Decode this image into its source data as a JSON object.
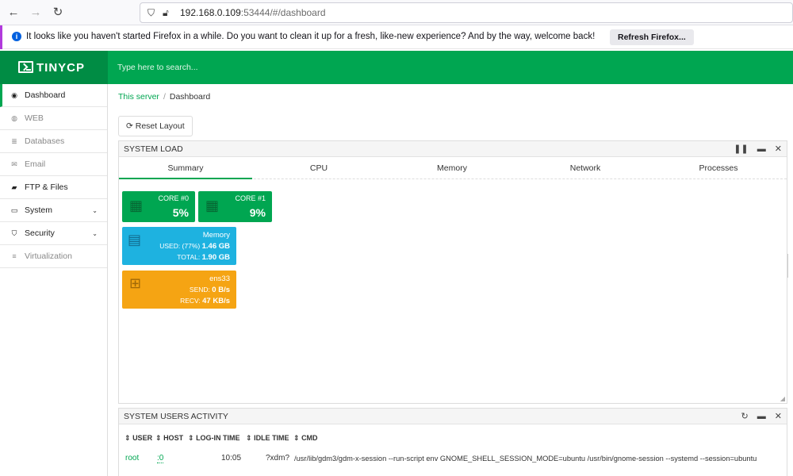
{
  "browser": {
    "back_icon": "←",
    "forward_icon": "→",
    "reload_icon": "↻",
    "url_host": "192.168.0.109",
    "url_rest": ":53444/#/dashboard"
  },
  "notification": {
    "text": "It looks like you haven't started Firefox in a while. Do you want to clean it up for a fresh, like-new experience? And by the way, welcome back!",
    "button": "Refresh Firefox..."
  },
  "header": {
    "logo": "TINYCP",
    "search_placeholder": "Type here to search..."
  },
  "sidebar": {
    "items": [
      {
        "label": "Dashboard",
        "icon": "◉"
      },
      {
        "label": "WEB",
        "icon": "◍"
      },
      {
        "label": "Databases",
        "icon": "≣"
      },
      {
        "label": "Email",
        "icon": "✉"
      },
      {
        "label": "FTP & Files",
        "icon": "▰"
      },
      {
        "label": "System",
        "icon": "▭",
        "chevron": "⌄"
      },
      {
        "label": "Security",
        "icon": "⛉",
        "chevron": "⌄"
      },
      {
        "label": "Virtualization",
        "icon": "≡"
      }
    ]
  },
  "breadcrumb": {
    "link": "This server",
    "sep": "/",
    "current": "Dashboard"
  },
  "reset_button": "Reset Layout",
  "system_load": {
    "title": "SYSTEM LOAD",
    "tools": [
      "❚❚",
      "▬",
      "✕"
    ],
    "tabs": [
      "Summary",
      "CPU",
      "Memory",
      "Network",
      "Processes"
    ],
    "cores": [
      {
        "label": "CORE #0",
        "value": "5%"
      },
      {
        "label": "CORE #1",
        "value": "9%"
      }
    ],
    "memory": {
      "title": "Memory",
      "used_label": "USED: (77%)",
      "used_value": "1.46 GB",
      "total_label": "TOTAL:",
      "total_value": "1.90 GB"
    },
    "network": {
      "title": "ens33",
      "send_label": "SEND:",
      "send_value": "0 B/s",
      "recv_label": "RECV:",
      "recv_value": "47 KB/s"
    },
    "colors": {
      "green": "#00a651",
      "blue": "#1eb2e0",
      "orange": "#f5a413"
    }
  },
  "users_activity": {
    "title": "SYSTEM USERS ACTIVITY",
    "tools": [
      "↻",
      "▬",
      "✕"
    ],
    "columns": [
      "USER",
      "HOST",
      "LOG-IN TIME",
      "IDLE TIME",
      "CMD"
    ],
    "sort_icon": "⇕",
    "rows": [
      {
        "user": "root",
        "host": ":0",
        "login": "10:05",
        "idle": "?xdm?",
        "cmd": "/usr/lib/gdm3/gdm-x-session --run-script env GNOME_SHELL_SESSION_MODE=ubuntu /usr/bin/gnome-session --systemd --session=ubuntu"
      }
    ]
  }
}
